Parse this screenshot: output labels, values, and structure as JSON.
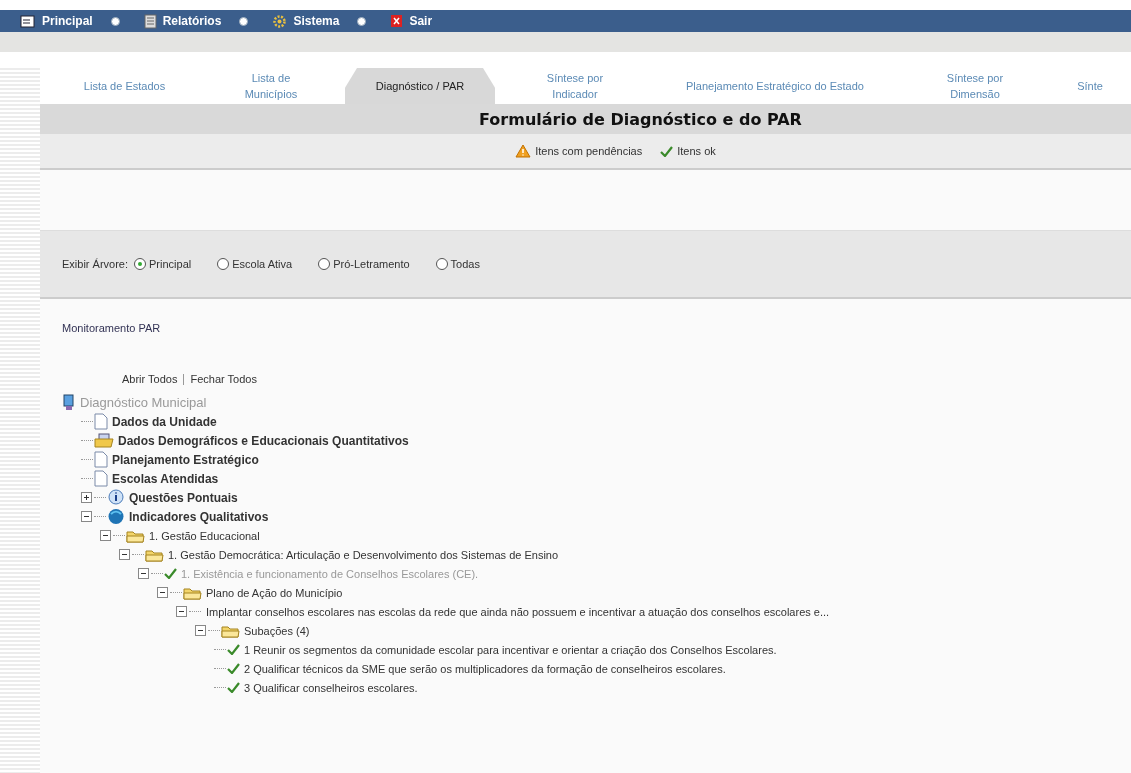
{
  "menu": [
    {
      "label": "Principal",
      "kind": "form",
      "dropdown": true
    },
    {
      "label": "Relatórios",
      "kind": "report",
      "dropdown": true
    },
    {
      "label": "Sistema",
      "kind": "gear",
      "dropdown": true
    },
    {
      "label": "Sair",
      "kind": "exit",
      "dropdown": false
    }
  ],
  "tabs": [
    {
      "label": "Lista de Estados",
      "selected": false
    },
    {
      "label": "Lista de Municípios",
      "selected": false
    },
    {
      "label": "Diagnóstico / PAR",
      "selected": true
    },
    {
      "label": "Síntese por Indicador",
      "selected": false
    },
    {
      "label": "Planejamento Estratégico do Estado",
      "selected": false
    },
    {
      "label": "Síntese por Dimensão",
      "selected": false
    },
    {
      "label": "Sínte",
      "selected": false
    }
  ],
  "title": "Formulário de Diagnóstico e do PAR",
  "legend": [
    {
      "kind": "warning",
      "label": "Itens com pendências"
    },
    {
      "kind": "ok",
      "label": "Itens ok"
    }
  ],
  "tree_filter": {
    "label": "Exibir Árvore:",
    "options": [
      {
        "label": "Principal",
        "selected": true
      },
      {
        "label": "Escola Ativa",
        "selected": false
      },
      {
        "label": "Pró-Letramento",
        "selected": false
      },
      {
        "label": "Todas",
        "selected": false
      }
    ]
  },
  "monitor_link": "Monitoramento PAR",
  "tree_actions": [
    "Abrir Todos",
    "Fechar Todos"
  ],
  "tree": {
    "label": "Diagnóstico Municipal",
    "kind": "computer",
    "children": [
      {
        "label": "Dados da Unidade",
        "kind": "doc",
        "bold": true
      },
      {
        "label": "Dados Demográficos e Educacionais Quantitativos",
        "kind": "chart-folder",
        "bold": true
      },
      {
        "label": "Planejamento Estratégico",
        "kind": "doc",
        "bold": true
      },
      {
        "label": "Escolas Atendidas",
        "kind": "doc",
        "bold": true
      },
      {
        "label": "Questões Pontuais",
        "kind": "info",
        "bold": true,
        "expanded": false
      },
      {
        "label": "Indicadores Qualitativos",
        "kind": "globe",
        "bold": true,
        "expanded": true,
        "children": [
          {
            "label": "1. Gestão Educacional",
            "kind": "folder",
            "expanded": true,
            "children": [
              {
                "label": "1. Gestão Democrática: Articulação e Desenvolvimento dos Sistemas de Ensino",
                "kind": "folder",
                "expanded": true,
                "children": [
                  {
                    "label": "1. Existência e funcionamento de Conselhos Escolares (CE).",
                    "kind": "check",
                    "muted": true,
                    "expanded": true,
                    "children": [
                      {
                        "label": "Plano de Ação do Município",
                        "kind": "folder",
                        "expanded": true,
                        "children": [
                          {
                            "label": "Implantar conselhos escolares nas escolas da rede que ainda não possuem e incentivar a atuação dos conselhos escolares e...",
                            "expanded": true,
                            "children": [
                              {
                                "label": "Subações (4)",
                                "kind": "folder",
                                "expanded": true,
                                "children": [
                                  {
                                    "label": "1 Reunir os segmentos da comunidade escolar para incentivar e orientar a criação dos Conselhos Escolares.",
                                    "kind": "check"
                                  },
                                  {
                                    "label": "2 Qualificar técnicos da SME que serão os multiplicadores da formação de conselheiros escolares.",
                                    "kind": "check"
                                  },
                                  {
                                    "label": "3 Qualificar conselheiros escolares.",
                                    "kind": "check"
                                  }
                                ]
                              }
                            ]
                          }
                        ]
                      }
                    ]
                  }
                ]
              }
            ]
          }
        ]
      }
    ]
  }
}
